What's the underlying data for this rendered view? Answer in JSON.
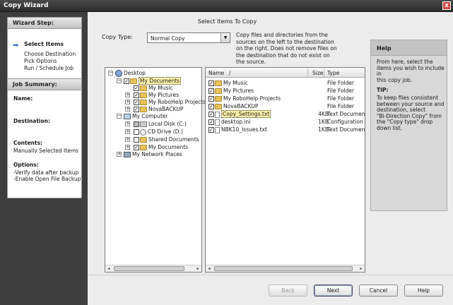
{
  "window": {
    "title": "Copy Wizard",
    "close_glyph": "x"
  },
  "wizard": {
    "header": "Wizard Step:",
    "steps": [
      {
        "label": "Select Items",
        "active": true
      },
      {
        "label": "Choose Destination"
      },
      {
        "label": "Pick Options"
      },
      {
        "label": "Run / Schedule Job"
      }
    ]
  },
  "job_summary": {
    "header": "Job Summary:",
    "name_label": "Name:",
    "destination_label": "Destination:",
    "contents_label": "Contents:",
    "contents_value": "Manually Selected Items",
    "options_label": "Options:",
    "options": [
      "-Verify data after backup",
      "-Enable Open File Backup"
    ]
  },
  "main": {
    "heading": "Select Items To Copy",
    "copy_type_label": "Copy Type:",
    "copy_type_value": "Normal Copy",
    "description_lines": [
      "Copy files and directories from the",
      "sources on the left to the destination",
      "on the right. Does not remove files on",
      "the destination that do not exist on",
      "the source."
    ]
  },
  "tree": {
    "items": [
      {
        "label": "Desktop",
        "icon": "desktop-icon"
      },
      {
        "label": "My Documents",
        "icon": "folder-icon"
      },
      {
        "label": "My Music",
        "icon": "folder-icon"
      },
      {
        "label": "My Pictures",
        "icon": "folder-icon"
      },
      {
        "label": "My RoboHelp Projects",
        "icon": "folder-icon"
      },
      {
        "label": "NovaBACKUP",
        "icon": "folder-icon"
      },
      {
        "label": "My Computer",
        "icon": "computer-icon"
      },
      {
        "label": "Local Disk (C:)",
        "icon": "drive-icon"
      },
      {
        "label": "CD Drive (D:)",
        "icon": "cd-drive-icon"
      },
      {
        "label": "Shared Documents",
        "icon": "folder-icon"
      },
      {
        "label": "My Documents",
        "icon": "folder-icon"
      },
      {
        "label": "My Network Places",
        "icon": "network-icon"
      }
    ]
  },
  "list": {
    "columns": {
      "name": "Name",
      "sort": "/",
      "size": "Size",
      "type": "Type"
    },
    "rows": [
      {
        "name": "My Music",
        "size": "",
        "type": "File Folder",
        "icon": "folder-icon"
      },
      {
        "name": "My Pictures",
        "size": "",
        "type": "File Folder",
        "icon": "folder-icon"
      },
      {
        "name": "My RoboHelp Projects",
        "size": "",
        "type": "File Folder",
        "icon": "folder-icon"
      },
      {
        "name": "NovaBACKUP",
        "size": "",
        "type": "File Folder",
        "icon": "folder-icon"
      },
      {
        "name": "Copy_Settings.txt",
        "size": "4KB",
        "type": "Text Document",
        "icon": "text-file-icon"
      },
      {
        "name": "desktop.ini",
        "size": "1KB",
        "type": "Configuration S",
        "icon": "settings-file-icon"
      },
      {
        "name": "NBK10_Issues.txt",
        "size": "1KB",
        "type": "Text Document",
        "icon": "text-file-icon"
      }
    ]
  },
  "help": {
    "title": "Help",
    "intro": [
      "From here, select the",
      "items you wish to include in",
      "this copy job."
    ],
    "tip_label": "TIP:",
    "tip": [
      "To keep files consistent",
      "between your source and",
      "destination, select",
      "\"Bi-Direction Copy\" from",
      "the \"Copy type\" drop",
      "down list."
    ]
  },
  "buttons": {
    "back": "Back",
    "next": "Next",
    "cancel": "Cancel",
    "help": "Help"
  },
  "glyphs": {
    "check": "✓",
    "minus": "−",
    "plus": "+",
    "left": "◂",
    "right": "▸",
    "dropdown": "▼",
    "step_arrow": "➡"
  }
}
